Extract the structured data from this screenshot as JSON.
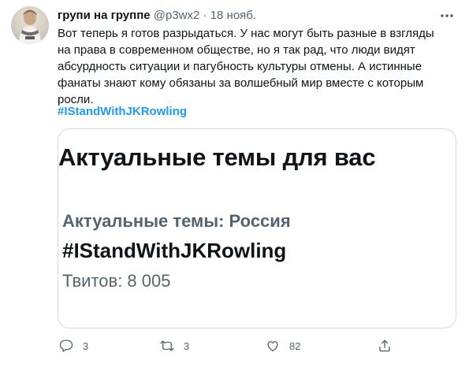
{
  "tweet": {
    "author_name": "групи на группе",
    "author_handle": "@p3wx2",
    "separator": "·",
    "date": "18 нояб.",
    "text": "Вот теперь я готов разрыдаться. У нас могут быть разные в взгляды на права в современном обществе, но я так рад, что люди видят абсурдность ситуации и пагубность культуры отмены. А истинные фанаты знают кому обязаны за волшебный мир вместе с которым росли.",
    "hashtag": "#IStandWithJKRowling"
  },
  "card": {
    "title": "Актуальные темы для вас",
    "context": "Актуальные темы: Россия",
    "trend": "#IStandWithJKRowling",
    "count": "Твитов: 8 005"
  },
  "actions": {
    "reply_count": "3",
    "retweet_count": "3",
    "like_count": "82",
    "share_count": ""
  },
  "icons": {
    "more": "more-icon",
    "reply": "reply-icon",
    "retweet": "retweet-icon",
    "like": "like-icon",
    "share": "share-icon"
  },
  "colors": {
    "link": "#1d9bf0",
    "secondary_text": "#536471",
    "primary_text": "#0f1419",
    "border": "#cfd9de"
  }
}
